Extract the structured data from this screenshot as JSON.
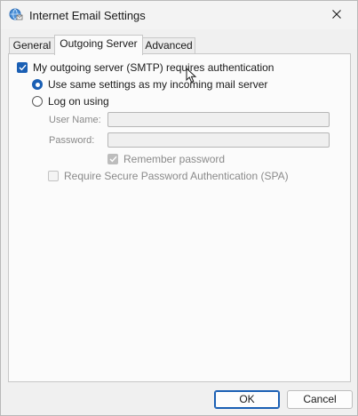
{
  "window": {
    "title": "Internet Email Settings",
    "icon": "globe-mail-icon",
    "close_icon": "close-icon"
  },
  "tabs": [
    {
      "label": "General",
      "active": false
    },
    {
      "label": "Outgoing Server",
      "active": true
    },
    {
      "label": "Advanced",
      "active": false
    }
  ],
  "outgoing": {
    "smtp_auth_label": "My outgoing server (SMTP) requires authentication",
    "smtp_auth_checked": true,
    "same_settings_label": "Use same settings as my incoming mail server",
    "same_settings_selected": true,
    "log_on_label": "Log on using",
    "log_on_selected": false,
    "username_label": "User Name:",
    "username_value": "",
    "password_label": "Password:",
    "password_value": "",
    "remember_label": "Remember password",
    "remember_checked": true,
    "spa_label": "Require Secure Password Authentication (SPA)",
    "spa_checked": false
  },
  "buttons": {
    "ok": "OK",
    "cancel": "Cancel"
  },
  "colors": {
    "accent": "#1a5fb4",
    "window_bg": "#f0f0f0",
    "panel_bg": "#fbfbfb",
    "disabled_text": "#8a8a8a"
  }
}
